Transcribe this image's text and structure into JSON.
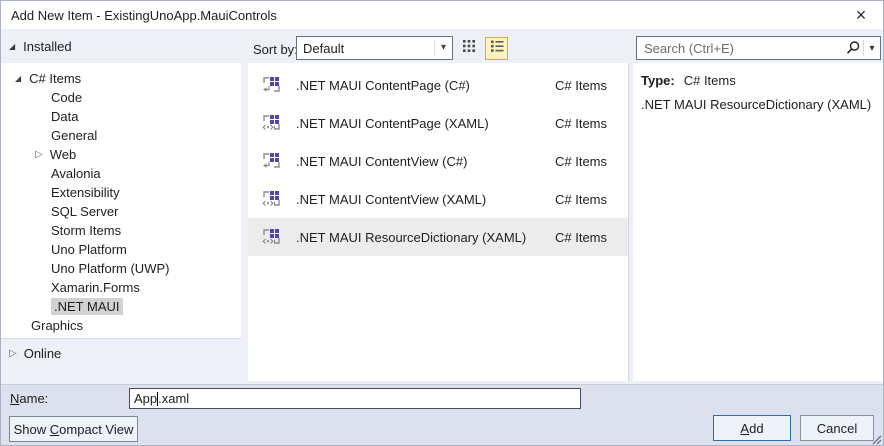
{
  "window": {
    "title": "Add New Item - ExistingUnoApp.MauiControls"
  },
  "icons": {
    "close_glyph": "×",
    "expanded_glyph": "◢",
    "collapsed_glyph": "▷",
    "dropdown_glyph": "▾",
    "search_icon": "magnifier",
    "grid_view_icon": "small-icons-grid",
    "list_view_icon": "list-lines",
    "csharp_item_icon": "purple-squares-with-arrow",
    "xaml_item_icon": "purple-squares-with-markup",
    "resize_grip_icon": "diagonal-grip-lines"
  },
  "header": {
    "installed_label": "Installed",
    "sort_by_label": "Sort by:",
    "sort_value": "Default",
    "search_placeholder": "Search (Ctrl+E)"
  },
  "tree": {
    "online_label": "Online",
    "items": [
      {
        "label": "C# Items",
        "state": "expanded"
      },
      {
        "label": "Code"
      },
      {
        "label": "Data"
      },
      {
        "label": "General"
      },
      {
        "label": "Web",
        "state": "collapsed"
      },
      {
        "label": "Avalonia"
      },
      {
        "label": "Extensibility"
      },
      {
        "label": "SQL Server"
      },
      {
        "label": "Storm Items"
      },
      {
        "label": "Uno Platform"
      },
      {
        "label": "Uno Platform (UWP)"
      },
      {
        "label": "Xamarin.Forms"
      },
      {
        "label": ".NET MAUI",
        "selected": true
      },
      {
        "label": "Graphics"
      }
    ]
  },
  "list": {
    "rows": [
      {
        "name": ".NET MAUI ContentPage (C#)",
        "type": "C# Items",
        "icon": "csharp-item-icon"
      },
      {
        "name": ".NET MAUI ContentPage (XAML)",
        "type": "C# Items",
        "icon": "xaml-item-icon"
      },
      {
        "name": ".NET MAUI ContentView (C#)",
        "type": "C# Items",
        "icon": "csharp-item-icon"
      },
      {
        "name": ".NET MAUI ContentView (XAML)",
        "type": "C# Items",
        "icon": "xaml-item-icon"
      },
      {
        "name": ".NET MAUI ResourceDictionary (XAML)",
        "type": "C# Items",
        "icon": "xaml-item-icon",
        "selected": true
      }
    ]
  },
  "details": {
    "type_label": "Type:",
    "type_value": "C# Items",
    "description": ".NET MAUI ResourceDictionary (XAML)"
  },
  "footer": {
    "name_mn": "N",
    "name_rest": "ame:",
    "name_value_before": "App",
    "name_value_after": ".xaml",
    "compact_pre": "Show ",
    "compact_mn": "C",
    "compact_rest": "ompact View",
    "add_mn": "A",
    "add_rest": "dd",
    "cancel_label": "Cancel"
  }
}
